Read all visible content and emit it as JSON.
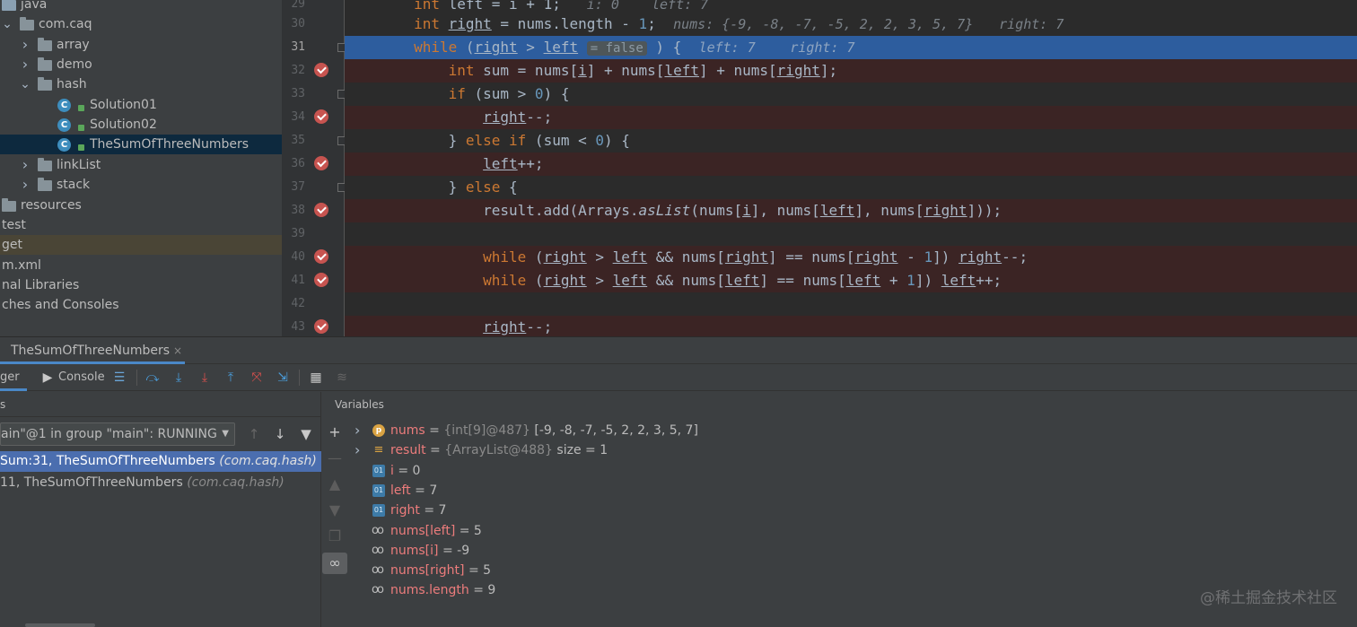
{
  "project_tree": {
    "items": [
      {
        "label": "java",
        "icon": "folder-icon",
        "depth": 0,
        "state": "none"
      },
      {
        "label": "com.caq",
        "icon": "package-icon",
        "depth": 0,
        "state": "expanded"
      },
      {
        "label": "array",
        "icon": "package-icon",
        "depth": 1,
        "state": "collapsed"
      },
      {
        "label": "demo",
        "icon": "package-icon",
        "depth": 1,
        "state": "collapsed"
      },
      {
        "label": "hash",
        "icon": "package-icon",
        "depth": 1,
        "state": "expanded"
      },
      {
        "label": "Solution01",
        "icon": "class-icon",
        "depth": 2,
        "state": "none"
      },
      {
        "label": "Solution02",
        "icon": "class-icon",
        "depth": 2,
        "state": "none"
      },
      {
        "label": "TheSumOfThreeNumbers",
        "icon": "class-icon",
        "depth": 2,
        "state": "selected"
      },
      {
        "label": "linkList",
        "icon": "package-icon",
        "depth": 1,
        "state": "collapsed"
      },
      {
        "label": "stack",
        "icon": "package-icon",
        "depth": 1,
        "state": "collapsed"
      },
      {
        "label": "resources",
        "icon": "resources-folder-icon",
        "depth": 0,
        "state": "none"
      },
      {
        "label": "test",
        "icon": "",
        "depth": 0,
        "state": "none"
      },
      {
        "label": "get",
        "icon": "",
        "depth": 0,
        "state": "highlighted"
      },
      {
        "label": "m.xml",
        "icon": "",
        "depth": 0,
        "state": "none"
      },
      {
        "label": "nal Libraries",
        "icon": "",
        "depth": 0,
        "state": "none"
      },
      {
        "label": "ches and Consoles",
        "icon": "",
        "depth": 0,
        "state": "none"
      }
    ]
  },
  "editor": {
    "lines": [
      {
        "num": "29",
        "breakpoint": false,
        "current": false
      },
      {
        "num": "30",
        "breakpoint": false,
        "current": false
      },
      {
        "num": "31",
        "breakpoint": false,
        "current": true
      },
      {
        "num": "32",
        "breakpoint": true,
        "current": false
      },
      {
        "num": "33",
        "breakpoint": false,
        "current": false
      },
      {
        "num": "34",
        "breakpoint": true,
        "current": false
      },
      {
        "num": "35",
        "breakpoint": false,
        "current": false
      },
      {
        "num": "36",
        "breakpoint": true,
        "current": false
      },
      {
        "num": "37",
        "breakpoint": false,
        "current": false
      },
      {
        "num": "38",
        "breakpoint": true,
        "current": false
      },
      {
        "num": "39",
        "breakpoint": false,
        "current": false
      },
      {
        "num": "40",
        "breakpoint": true,
        "current": false
      },
      {
        "num": "41",
        "breakpoint": true,
        "current": false
      },
      {
        "num": "42",
        "breakpoint": false,
        "current": false
      },
      {
        "num": "43",
        "breakpoint": true,
        "current": false
      }
    ],
    "code": {
      "l29": {
        "kw": "int",
        "rest": " left = i + 1;",
        "hint": "i: 0    left: 7"
      },
      "l30": {
        "kw": "int",
        "var": "right",
        "rest": " = nums.length - ",
        "num": "1",
        "end": ";",
        "hint": "nums: {-9, -8, -7, -5, 2, 2, 3, 5, 7}",
        "hint2": "right: 7"
      },
      "l31": {
        "kw": "while",
        "open": " (",
        "v1": "right",
        "op": " > ",
        "v2": "left",
        "inline": "= false",
        "close": " ) {",
        "hint_left": "left: 7",
        "hint_right": "right: 7"
      },
      "l32": {
        "kw": "int",
        "pre": " sum = nums[",
        "v1": "i",
        "mid1": "] + nums[",
        "v2": "left",
        "mid2": "] + nums[",
        "v3": "right",
        "end": "];"
      },
      "l33": {
        "kw": "if",
        "pre": " (sum > ",
        "num": "0",
        "end": ") {"
      },
      "l34": {
        "v": "right",
        "end": "--;"
      },
      "l35": {
        "pre": "} ",
        "kw1": "else",
        "sp": " ",
        "kw2": "if",
        "mid": " (sum < ",
        "num": "0",
        "end": ") {"
      },
      "l36": {
        "v": "left",
        "end": "++;"
      },
      "l37": {
        "pre": "} ",
        "kw": "else",
        "end": " {"
      },
      "l38": {
        "pre": "result.add(Arrays.",
        "m": "asList",
        "a": "(nums[",
        "v1": "i",
        "b": "], nums[",
        "v2": "left",
        "c": "], nums[",
        "v3": "right",
        "end": "]));"
      },
      "l40": {
        "kw": "while",
        "a": " (",
        "v1": "right",
        "b": " > ",
        "v2": "left",
        "c": " && nums[",
        "v3": "right",
        "d": "] == nums[",
        "v4": "right",
        "e": " - ",
        "num": "1",
        "f": "]) ",
        "v5": "right",
        "end": "--;"
      },
      "l41": {
        "kw": "while",
        "a": " (",
        "v1": "right",
        "b": " > ",
        "v2": "left",
        "c": " && nums[",
        "v3": "left",
        "d": "] == nums[",
        "v4": "left",
        "e": " + ",
        "num": "1",
        "f": "]) ",
        "v5": "left",
        "end": "++;"
      },
      "l43": {
        "v": "right",
        "end": "--;"
      }
    }
  },
  "debug": {
    "tab_title": "TheSumOfThreeNumbers",
    "tab_close": "×",
    "debugger_tab": "ger",
    "console_tab": "Console",
    "frames_header": "s",
    "thread_select": "ain\"@1 in group \"main\": RUNNING",
    "frames": [
      {
        "method": "Sum:31, TheSumOfThreeNumbers",
        "pkg": "(com.caq.hash)",
        "selected": true
      },
      {
        "method": "11, TheSumOfThreeNumbers",
        "pkg": "(com.caq.hash)",
        "selected": false
      }
    ],
    "variables_header": "Variables",
    "variables": [
      {
        "name": "nums",
        "eq": " = ",
        "type": "{int[9]@487}",
        "value": " [-9, -8, -7, -5, 2, 2, 3, 5, 7]",
        "icon": "param-icon",
        "expandable": true
      },
      {
        "name": "result",
        "eq": " = ",
        "type": "{ArrayList@488}",
        "value": "  size = 1",
        "icon": "list-icon",
        "expandable": true
      },
      {
        "name": "i",
        "eq": " = ",
        "type": "",
        "value": "0",
        "icon": "primitive-icon",
        "expandable": false
      },
      {
        "name": "left",
        "eq": " = ",
        "type": "",
        "value": "7",
        "icon": "primitive-icon",
        "expandable": false
      },
      {
        "name": "right",
        "eq": " = ",
        "type": "",
        "value": "7",
        "icon": "primitive-icon",
        "expandable": false
      },
      {
        "name": "nums[left]",
        "eq": " = ",
        "type": "",
        "value": "5",
        "icon": "watch-icon",
        "expandable": false
      },
      {
        "name": "nums[i]",
        "eq": " = ",
        "type": "",
        "value": "-9",
        "icon": "watch-icon",
        "expandable": false
      },
      {
        "name": "nums[right]",
        "eq": " = ",
        "type": "",
        "value": "5",
        "icon": "watch-icon",
        "expandable": false
      },
      {
        "name": "nums.length",
        "eq": " = ",
        "type": "",
        "value": "9",
        "icon": "watch-icon",
        "expandable": false
      }
    ]
  },
  "watermark": "@稀土掘金技术社区",
  "colors": {
    "accent": "#4a88c7",
    "selection": "#4b6eaf",
    "current_line": "#2d5d9e",
    "breakpoint": "#c75450",
    "keyword": "#cc7832",
    "number": "#6897bb"
  }
}
